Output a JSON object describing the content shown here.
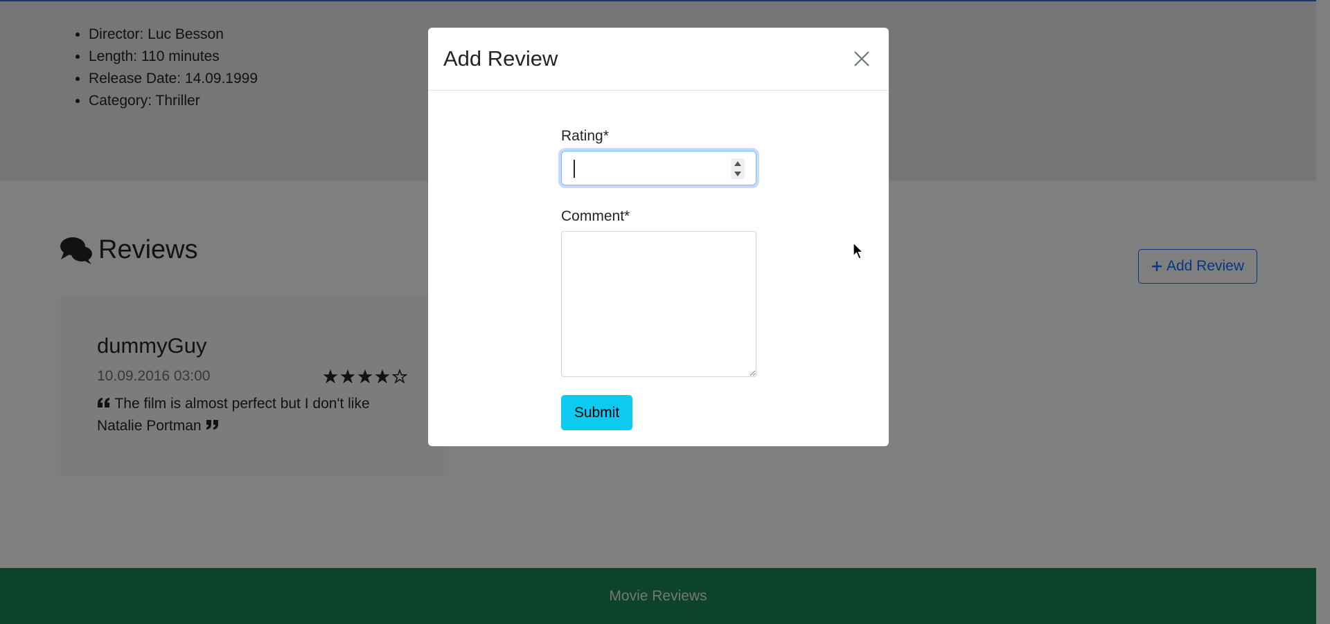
{
  "movie_details": [
    "Director: Luc Besson",
    "Length: 110 minutes",
    "Release Date: 14.09.1999",
    "Category: Thriller"
  ],
  "reviews": {
    "heading": "Reviews",
    "add_button_label": "Add Review",
    "items": [
      {
        "author": "dummyGuy",
        "date": "10.09.2016 03:00",
        "rating": 4,
        "max_rating": 5,
        "text": "The film is almost perfect but I don't like Natalie Portman"
      }
    ]
  },
  "footer": {
    "text": "Movie Reviews"
  },
  "modal": {
    "title": "Add Review",
    "rating_label": "Rating*",
    "rating_value": "",
    "comment_label": "Comment*",
    "comment_value": "",
    "submit_label": "Submit"
  },
  "colors": {
    "primary": "#0d6efd",
    "info": "#0dcaf0",
    "footer": "#198754",
    "backdrop": "#000000"
  },
  "icons": [
    "comments-icon",
    "plus-icon",
    "star-filled-icon",
    "star-empty-icon",
    "quote-left-icon",
    "quote-right-icon",
    "close-icon",
    "spinner-up-icon",
    "spinner-down-icon",
    "mouse-cursor-icon"
  ]
}
